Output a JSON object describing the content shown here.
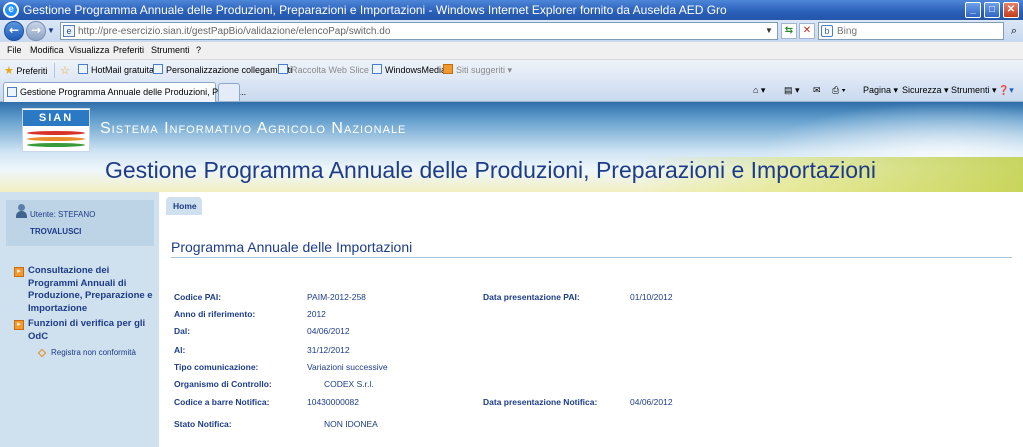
{
  "window": {
    "title": "Gestione Programma Annuale delle Produzioni, Preparazioni e Importazioni - Windows Internet Explorer fornito da Auselda AED Gro",
    "buttons": {
      "minimize": "_",
      "maximize": "□",
      "close": "✕"
    }
  },
  "address": {
    "url_host": "http://pre-esercizio.sian.it",
    "url_path": "/gestPapBio/validazione/elencoPap/switch.do",
    "search_placeholder": "Bing"
  },
  "menu": [
    "File",
    "Modifica",
    "Visualizza",
    "Preferiti",
    "Strumenti",
    "?"
  ],
  "favorites": {
    "label": "Preferiti",
    "items": [
      {
        "label": "HotMail gratuita",
        "enabled": true
      },
      {
        "label": "Personalizzazione collegamenti",
        "enabled": true
      },
      {
        "label": "Raccolta Web Slice ▾",
        "enabled": false
      },
      {
        "label": "WindowsMedia",
        "enabled": true
      },
      {
        "label": "Siti suggeriti ▾",
        "enabled": false
      }
    ]
  },
  "tabs": {
    "active_label": "Gestione Programma Annuale delle Produzioni, Prepar...",
    "commands": [
      "Pagina ▾",
      "Sicurezza ▾",
      "Strumenti ▾"
    ]
  },
  "banner": {
    "logo_text": "SIAN",
    "system_name": "Sistema Informativo Agricolo Nazionale",
    "app_title": "Gestione Programma Annuale delle Produzioni, Preparazioni e Importazioni"
  },
  "sidebar": {
    "user_label": "Utente: STEFANO",
    "user_label_2": "TROVALUSCI",
    "menu": [
      {
        "label": "Consultazione dei Programmi Annuali di Produzione, Preparazione e Importazione"
      },
      {
        "label": "Funzioni di verifica per gli OdC"
      }
    ],
    "submenu": [
      {
        "label": "Registra non conformità"
      }
    ]
  },
  "breadcrumb": {
    "home": "Home"
  },
  "main": {
    "heading": "Programma Annuale delle Importazioni",
    "fields": {
      "codice_pai": {
        "label": "Codice PAI:",
        "value": "PAIM-2012-258"
      },
      "data_presentazione_pai": {
        "label": "Data presentazione PAI:",
        "value": "01/10/2012"
      },
      "anno": {
        "label": "Anno di riferimento:",
        "value": "2012"
      },
      "dal": {
        "label": "Dal:",
        "value": "04/06/2012"
      },
      "al": {
        "label": "Al:",
        "value": "31/12/2012"
      },
      "tipo_comunicazione": {
        "label": "Tipo comunicazione:",
        "value": "Variazioni successive"
      },
      "organismo": {
        "label": "Organismo di Controllo:",
        "value": "CODEX S.r.l."
      },
      "codice_barre": {
        "label": "Codice a barre Notifica:",
        "value": "10430000082"
      },
      "data_presentazione_notifica": {
        "label": "Data presentazione Notifica:",
        "value": "04/06/2012"
      },
      "stato": {
        "label": "Stato Notifica:",
        "value": "NON IDONEA"
      }
    }
  }
}
